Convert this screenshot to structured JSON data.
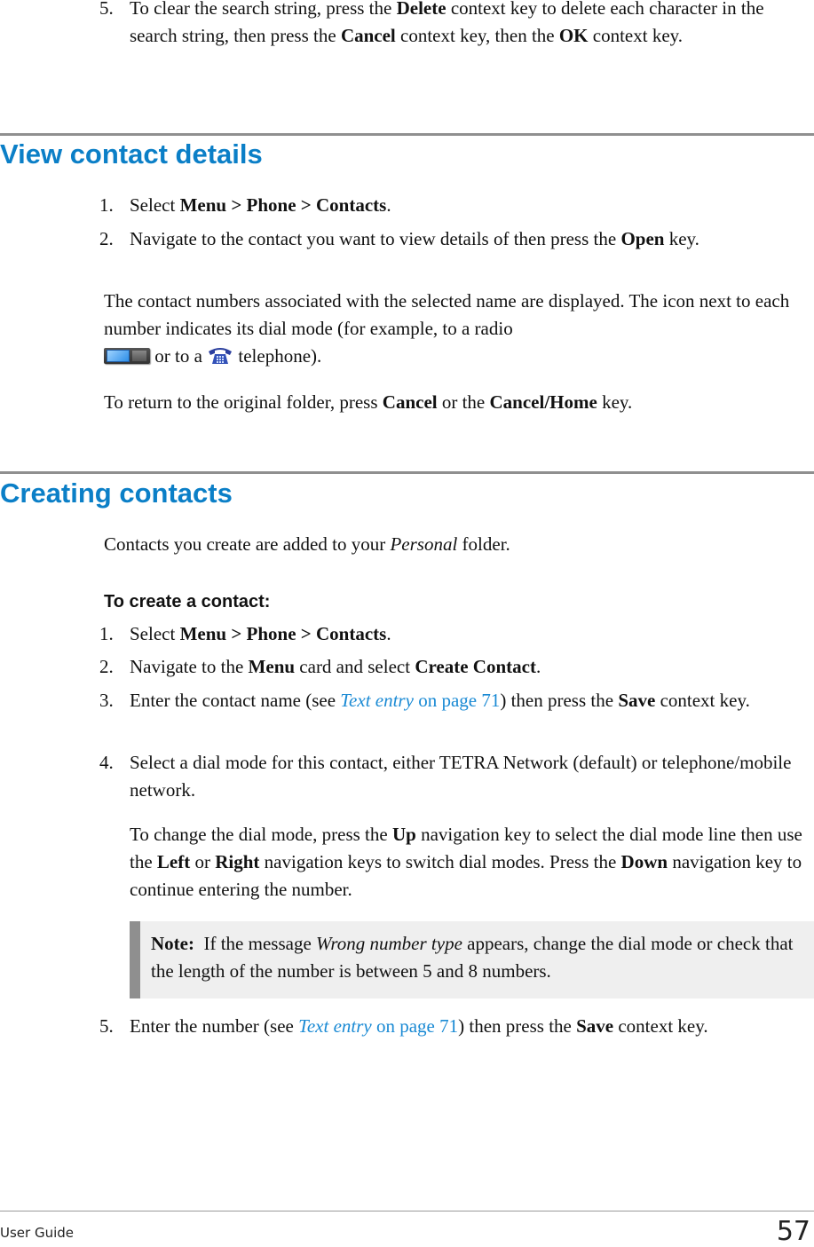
{
  "top_step": {
    "number": "5.",
    "parts": [
      "To clear the search string, press the ",
      "Delete",
      " context key to delete each character in the search string, then press the ",
      "Cancel",
      " context key, then the ",
      "OK",
      " context key."
    ]
  },
  "section1": {
    "title": "View contact details",
    "steps": [
      {
        "number": "1.",
        "parts": [
          "Select ",
          "Menu > Phone > Contacts",
          "."
        ]
      },
      {
        "number": "2.",
        "parts": [
          "Navigate to the contact you want to view details of then press the ",
          "Open",
          " key."
        ]
      }
    ],
    "para1": {
      "text_a": "The contact numbers associated with the selected name are displayed. The icon next to each number indicates its dial mode (for example, to a radio",
      "text_b": " or to a ",
      "text_c": " telephone).",
      "icons": [
        "radio-icon",
        "telephone-icon"
      ]
    },
    "para2": {
      "parts": [
        "To return to the original folder, press ",
        "Cancel",
        " or the ",
        "Cancel/Home",
        " key."
      ]
    }
  },
  "section2": {
    "title": "Creating contacts",
    "intro": {
      "parts": [
        "Contacts you create are added to your ",
        "Personal",
        " folder."
      ]
    },
    "procedure_title": "To create a contact:",
    "steps": [
      {
        "number": "1.",
        "parts": [
          "Select ",
          "Menu > Phone > Contacts",
          "."
        ]
      },
      {
        "number": "2.",
        "parts": [
          "Navigate to the ",
          "Menu",
          " card and select ",
          "Create Contact",
          "."
        ]
      },
      {
        "number": "3.",
        "parts": [
          "Enter the contact name (see ",
          "Text entry",
          " on page 71",
          ") then press the ",
          "Save",
          " context key."
        ]
      },
      {
        "number": "4.",
        "parts": [
          "Select a dial mode for this contact, either TETRA Network (default) or telephone/mobile network."
        ]
      },
      {
        "number": "5.",
        "parts": [
          "Enter the number (see ",
          "Text entry",
          " on page 71",
          ") then press the ",
          "Save",
          " context key."
        ]
      }
    ],
    "sub_para": {
      "parts": [
        "To change the dial mode, press the ",
        "Up",
        " navigation key to select the dial mode line then use the ",
        "Left",
        " or ",
        "Right",
        " navigation keys to switch dial modes. Press the ",
        "Down",
        " navigation key to continue entering the number."
      ]
    },
    "note": {
      "label": "Note:",
      "parts": [
        "  If the message ",
        "Wrong number type",
        " appears, change the dial mode or check that the length of the number is between 5 and 8 numbers."
      ]
    }
  },
  "footer": {
    "left": "User Guide",
    "page_number": "57"
  },
  "colors": {
    "heading": "#0b7fc7",
    "link": "#1a8ad4",
    "rule": "#8f8f8f",
    "note_bg": "#efefef"
  }
}
